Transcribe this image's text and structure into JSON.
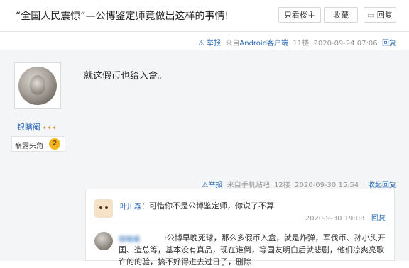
{
  "header": {
    "title": "“全国人民震惊”—公博鉴定师竟做出这样的事情!",
    "only_author_label": "只看楼主",
    "favorite_label": "收藏",
    "reply_label": "回复"
  },
  "floor11": {
    "report": "举报",
    "from_prefix": "来自",
    "client": "Android客户端",
    "floor": "11楼",
    "time": "2020-09-24 07:06",
    "reply": "回复",
    "user": {
      "name": "银瞎阉",
      "rank": "崭露头角",
      "level": "2"
    },
    "content": "就这假币也给入盒。"
  },
  "floor12": {
    "report": "举报",
    "from": "来自手机贴吧",
    "floor": "12楼",
    "time": "2020-09-30 15:54",
    "collapse": "收起回复"
  },
  "comments": [
    {
      "user": "叶川森",
      "text": "可惜你不是公博鉴定师，你说了不算",
      "time": "2020-9-30 19:03",
      "reply": "回复"
    },
    {
      "user": "银瞎阉",
      "text": "公博早晚死球，那么多假币入盒，就是炸弹，军伐币、孙小头开国、造总等，基本没有真品，现在谁倒，等国友明白后就悲剧，他们凉爽亮歌许的的验，搞不好得进去过日子，删除"
    }
  ],
  "colors": {
    "link": "#2a6ab6",
    "medal": "#f2b51b"
  }
}
